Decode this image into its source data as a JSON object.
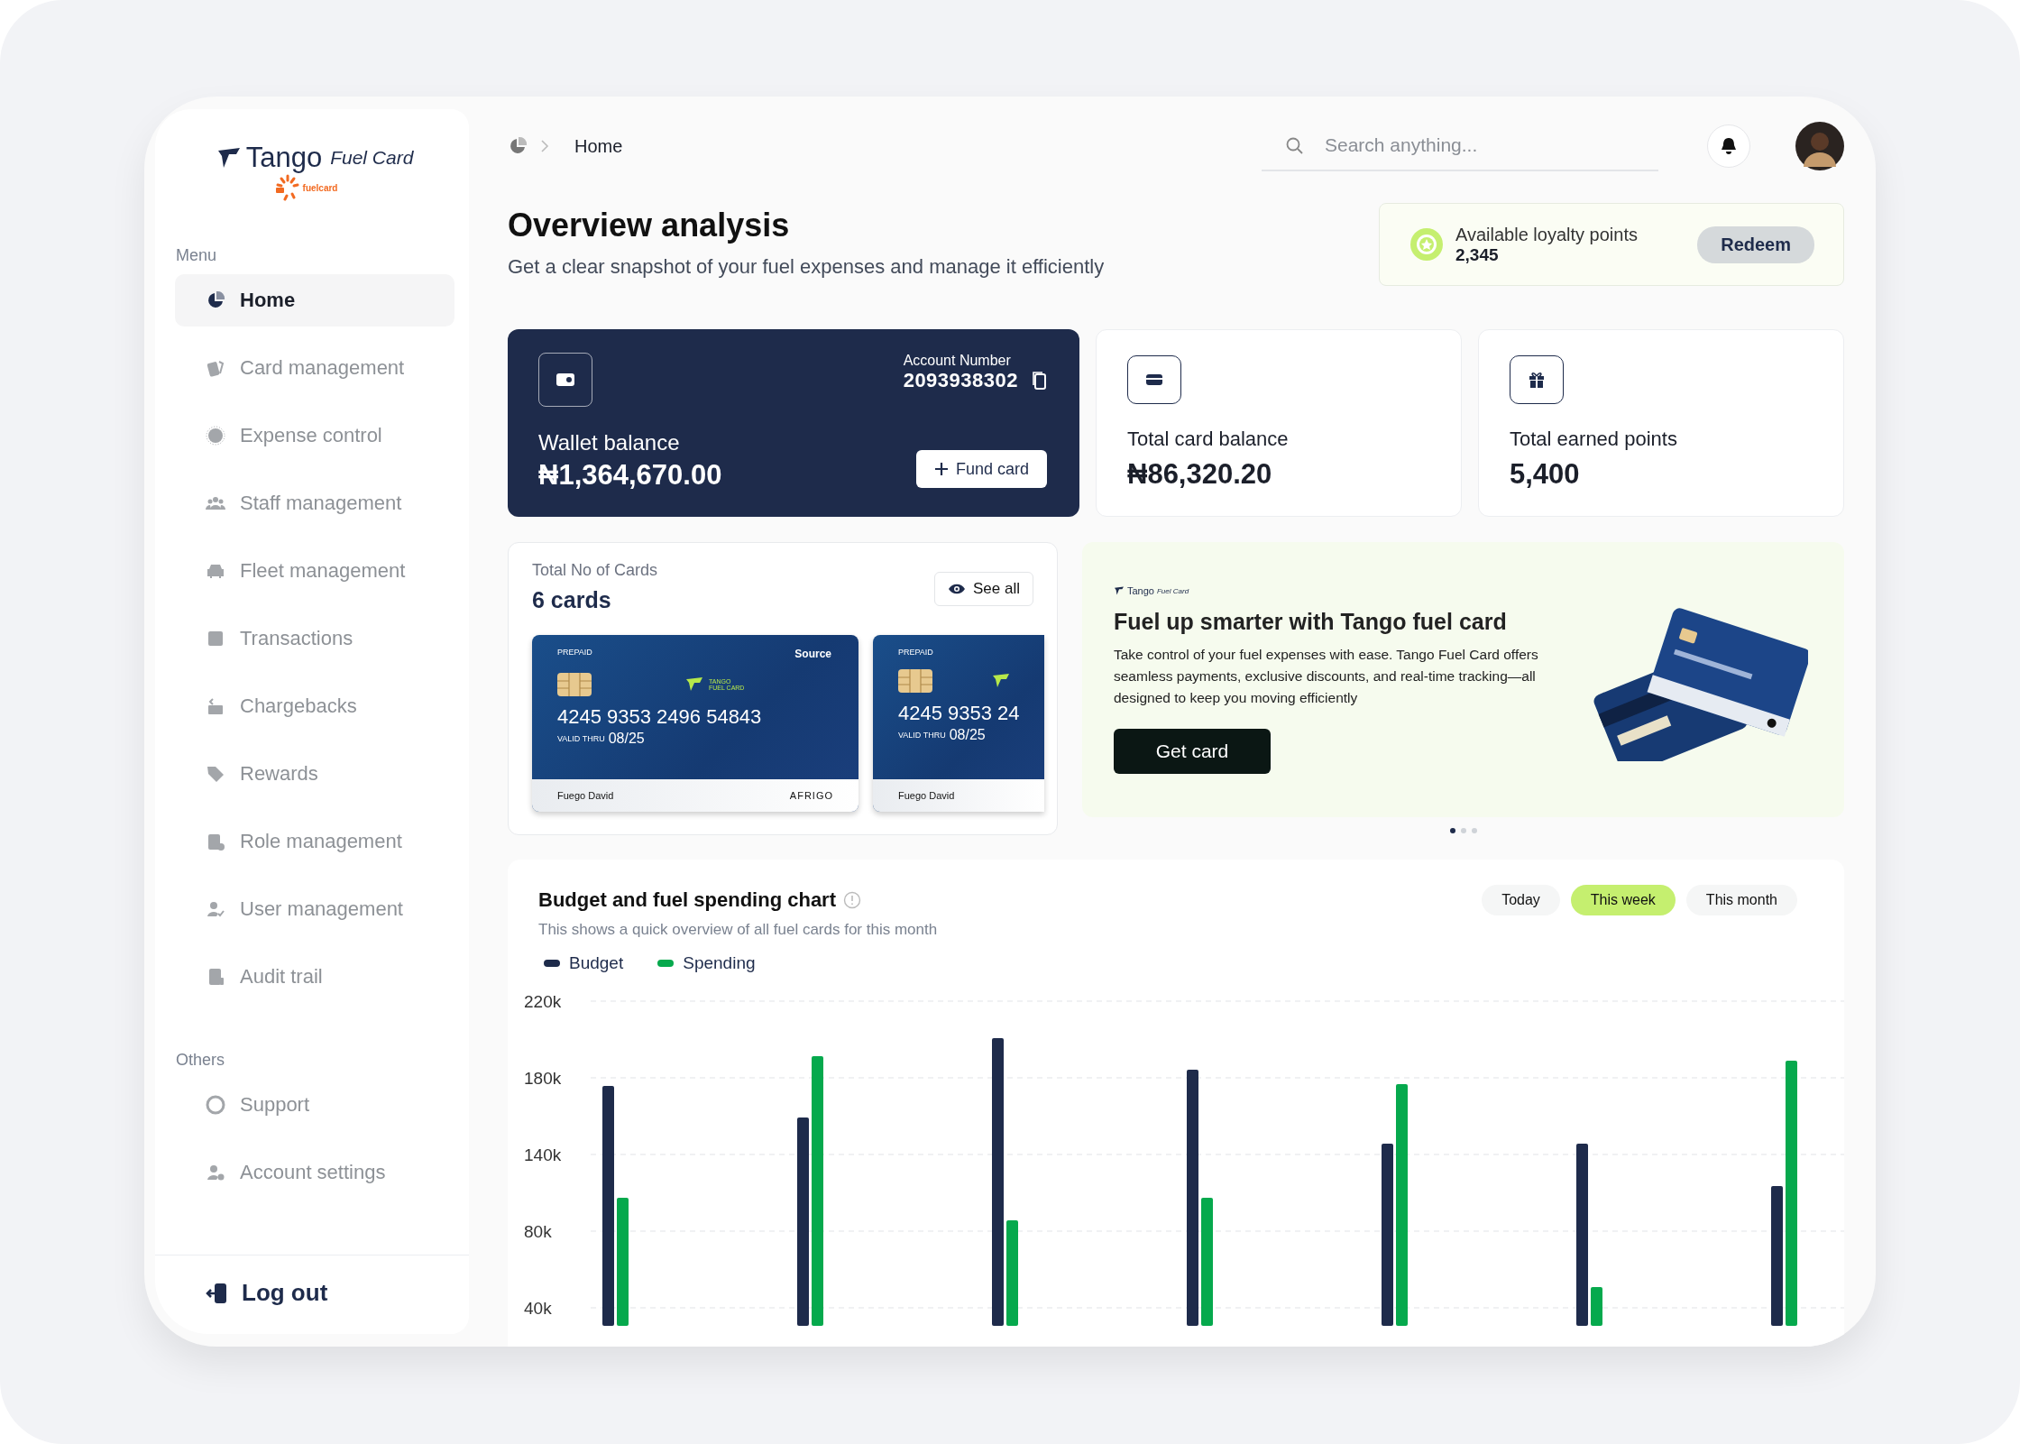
{
  "sidebar": {
    "logo": {
      "name": "Tango",
      "tagline": "Fuel Card",
      "sub": "fuelcard"
    },
    "sections": [
      {
        "title": "Menu",
        "items": [
          {
            "label": "Home",
            "selected": true
          },
          {
            "label": "Card management",
            "selected": false
          },
          {
            "label": "Expense control",
            "selected": false
          },
          {
            "label": "Staff management",
            "selected": false
          },
          {
            "label": "Fleet management",
            "selected": false
          },
          {
            "label": "Transactions",
            "selected": false
          },
          {
            "label": "Chargebacks",
            "selected": false
          },
          {
            "label": "Rewards",
            "selected": false
          },
          {
            "label": "Role management",
            "selected": false
          },
          {
            "label": "User management",
            "selected": false
          },
          {
            "label": "Audit trail",
            "selected": false
          }
        ]
      },
      {
        "title": "Others",
        "items": [
          {
            "label": "Support",
            "selected": false
          },
          {
            "label": "Account settings",
            "selected": false
          }
        ]
      }
    ],
    "logout": "Log out"
  },
  "header": {
    "breadcrumb": "Home",
    "search": {
      "placeholder": "Search anything..."
    }
  },
  "page": {
    "title": "Overview analysis",
    "subtitle": "Get a clear snapshot of your fuel expenses and manage it efficiently"
  },
  "loyalty": {
    "label": "Available loyalty points",
    "value": "2,345",
    "button": "Redeem"
  },
  "wallet": {
    "label": "Wallet balance",
    "amount": "₦1,364,670.00",
    "account_label": "Account Number",
    "account_number": "2093938302",
    "button": "Fund card"
  },
  "stats": [
    {
      "label": "Total card balance",
      "value": "₦86,320.20"
    },
    {
      "label": "Total earned points",
      "value": "5,400"
    }
  ],
  "cards_panel": {
    "label": "Total No of Cards",
    "count": "6 cards",
    "button": "See all",
    "cards": [
      {
        "type": "PREPAID",
        "bank": "Source",
        "brand": "TANGO FUEL CARD",
        "number": "4245 9353 2496 54843",
        "valid": "VALID THRU",
        "expiry": "08/25",
        "holder": "Fuego David",
        "network": "AFRIGO"
      },
      {
        "type": "PREPAID",
        "number": "4245 9353 24",
        "valid": "VALID THRU",
        "expiry": "08/25",
        "holder": "Fuego David"
      }
    ]
  },
  "promo": {
    "brand": "Tango",
    "brand_tag": "Fuel Card",
    "title": "Fuel up smarter with Tango fuel card",
    "text": "Take control of your fuel expenses with ease. Tango Fuel Card offers seamless payments, exclusive discounts, and real-time tracking—all designed to keep you moving efficiently",
    "button": "Get card",
    "slides": [
      {
        "selected": true
      },
      {
        "selected": false
      },
      {
        "selected": false
      }
    ]
  },
  "chart": {
    "title": "Budget and fuel spending chart",
    "subtitle": "This shows a quick overview of all fuel cards for this month",
    "ranges": [
      {
        "label": "Today",
        "selected": false
      },
      {
        "label": "This week",
        "selected": true
      },
      {
        "label": "This month",
        "selected": false
      }
    ],
    "legend": [
      {
        "label": "Budget",
        "color": "#1e2b4b"
      },
      {
        "label": "Spending",
        "color": "#06a94d"
      }
    ],
    "y_labels": [
      "220k",
      "180k",
      "140k",
      "80k",
      "40k"
    ]
  }
}
